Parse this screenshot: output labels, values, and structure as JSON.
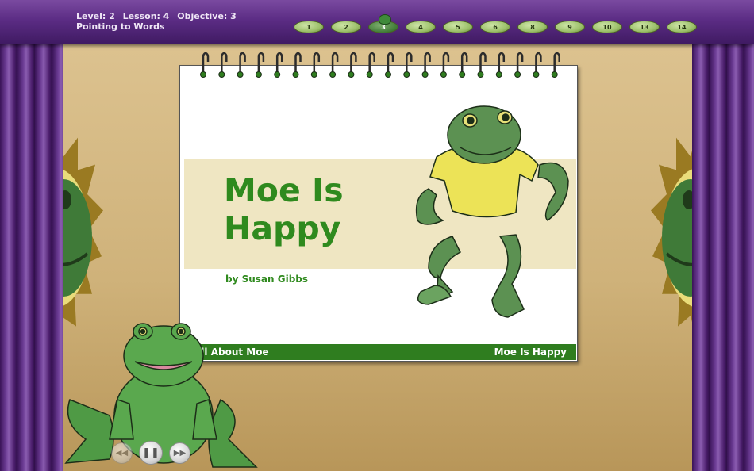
{
  "header": {
    "level": "Level: 2",
    "lesson": "Lesson: 4",
    "objective": "Objective: 3",
    "subtitle": "Pointing to Words",
    "lily_pads": [
      "1",
      "2",
      "3",
      "4",
      "5",
      "6",
      "8",
      "9",
      "10",
      "13",
      "14"
    ],
    "current_pad": "3"
  },
  "book": {
    "title_line1": "Moe Is",
    "title_line2": "Happy",
    "byline": "by Susan Gibbs",
    "footer_left": "All About Moe",
    "footer_right": "Moe Is Happy"
  },
  "colors": {
    "title_green": "#2f8a1e",
    "footer_green": "#2f7d1f",
    "header_purple": "#5b2c84",
    "band_cream": "#efe6c2"
  },
  "controls": {
    "rewind_icon": "rewind-icon",
    "pause_icon": "pause-icon",
    "forward_icon": "fast-forward-icon",
    "rewind_glyph": "◀◀",
    "pause_glyph": "❚❚",
    "forward_glyph": "▶▶"
  }
}
